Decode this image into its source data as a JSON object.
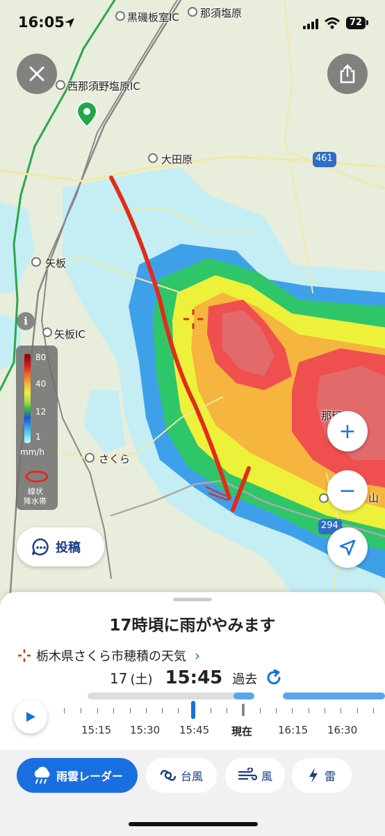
{
  "status_bar": {
    "time": "16:05",
    "battery": "72"
  },
  "map": {
    "places": [
      {
        "name": "黒磯板室IC",
        "icon": "interchange-marker"
      },
      {
        "name": "那須塩原",
        "icon": "station-marker"
      },
      {
        "name": "西那須野塩原IC",
        "icon": "interchange-marker"
      },
      {
        "name": "大田原",
        "icon": "city-marker"
      },
      {
        "name": "矢板",
        "icon": "city-marker"
      },
      {
        "name": "矢板IC",
        "icon": "interchange-marker"
      },
      {
        "name": "さくら",
        "icon": "city-marker"
      },
      {
        "name": "那珂",
        "icon": "city-marker"
      },
      {
        "name": "山",
        "icon": "city-marker"
      }
    ],
    "road_labels": [
      "461",
      "294"
    ],
    "info_icon": "i"
  },
  "legend": {
    "ticks": [
      "80",
      "40",
      "12",
      "1"
    ],
    "unit": "mm/h",
    "band_label_line1": "線状",
    "band_label_line2": "降水帯"
  },
  "post_button": {
    "label": "投稿"
  },
  "panel": {
    "headline": "17時頃に雨がやみます",
    "location": "栃木県さくら市穂積の天気",
    "date": "17",
    "weekday": "(土)",
    "time": "15:45",
    "mode": "過去",
    "time_labels": [
      "15:15",
      "15:30",
      "15:45",
      "現在",
      "16:15",
      "16:30"
    ]
  },
  "tabs": [
    {
      "label": "雨雲レーダー",
      "icon": "rain-cloud-icon",
      "active": true
    },
    {
      "label": "台風",
      "icon": "typhoon-icon",
      "active": false
    },
    {
      "label": "風",
      "icon": "wind-icon",
      "active": false
    },
    {
      "label": "雷",
      "icon": "lightning-icon",
      "active": false
    }
  ],
  "colors": {
    "accent": "#1a6fe0",
    "annotation": "#e32b19"
  }
}
